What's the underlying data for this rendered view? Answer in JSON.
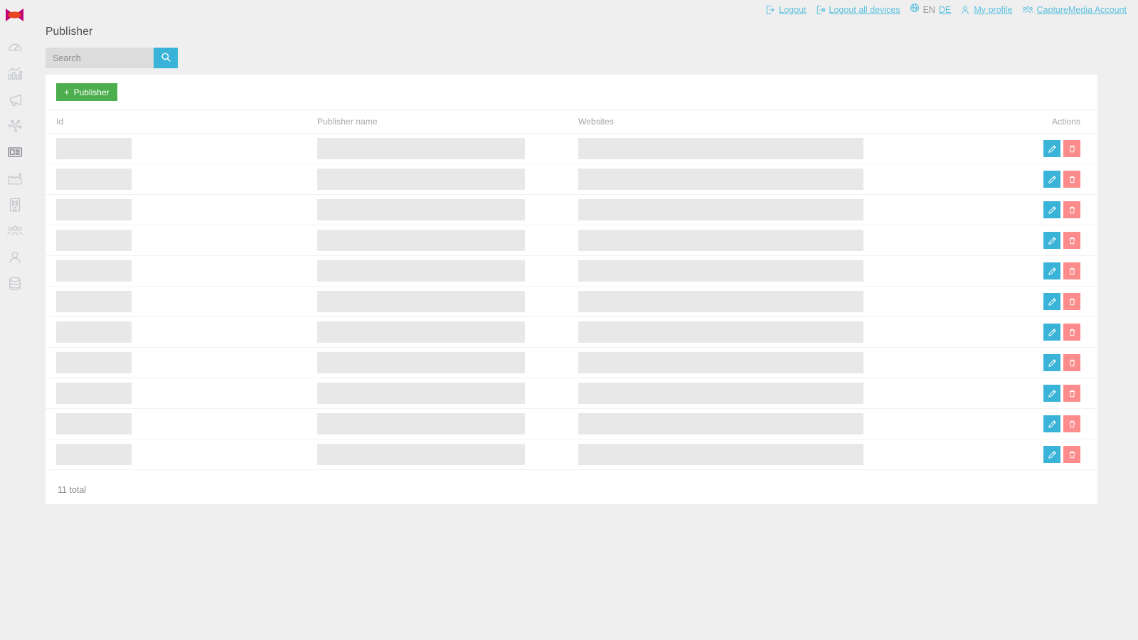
{
  "topbar": {
    "items": [
      {
        "icon": "logout-icon",
        "label": "Logout"
      },
      {
        "icon": "logout-all-devices-icon",
        "label": "Logout all devices"
      },
      {
        "icon": "my-profile-icon",
        "label": "My profile"
      },
      {
        "icon": "account-icon",
        "label": "CaptureMedia Account"
      }
    ],
    "logout_label": "Logout",
    "logout_all_label": "Logout all devices",
    "profile_label": "My profile",
    "account_label": "CaptureMedia Account",
    "language": {
      "icon": "globe-icon",
      "current": "EN",
      "other": "DE"
    },
    "link_color": "#5bc0de"
  },
  "sidebar": {
    "logo": "capturemedia-logo",
    "items": [
      {
        "icon": "gauge-icon",
        "name": "dashboard",
        "active": false
      },
      {
        "icon": "bar-chart-icon",
        "name": "statistics",
        "active": false
      },
      {
        "icon": "megaphone-icon",
        "name": "campaigns",
        "active": false
      },
      {
        "icon": "network-nodes-icon",
        "name": "network",
        "active": false
      },
      {
        "icon": "newspaper-icon",
        "name": "publisher",
        "active": true
      },
      {
        "icon": "factory-icon",
        "name": "advertiser",
        "active": false
      },
      {
        "icon": "building-icon",
        "name": "agency",
        "active": false
      },
      {
        "icon": "people-group-icon",
        "name": "users",
        "active": false
      },
      {
        "icon": "person-icon",
        "name": "profile",
        "active": false
      },
      {
        "icon": "database-icon",
        "name": "data",
        "active": false
      }
    ],
    "toggle": {
      "icon": "chevron-right-icon",
      "name": "expand-sidebar"
    }
  },
  "page": {
    "title": "Publisher"
  },
  "search": {
    "placeholder": "Search",
    "value": "",
    "button_icon": "search-icon"
  },
  "toolbar": {
    "add_label": "Publisher",
    "add_prefix": "+",
    "add_color": "#4cae4c"
  },
  "table": {
    "columns": [
      "Id",
      "Publisher name",
      "Websites",
      "Actions"
    ],
    "row_count": 11,
    "loading": true,
    "rows": [
      {
        "id": "",
        "publisher_name": "",
        "websites": ""
      },
      {
        "id": "",
        "publisher_name": "",
        "websites": ""
      },
      {
        "id": "",
        "publisher_name": "",
        "websites": ""
      },
      {
        "id": "",
        "publisher_name": "",
        "websites": ""
      },
      {
        "id": "",
        "publisher_name": "",
        "websites": ""
      },
      {
        "id": "",
        "publisher_name": "",
        "websites": ""
      },
      {
        "id": "",
        "publisher_name": "",
        "websites": ""
      },
      {
        "id": "",
        "publisher_name": "",
        "websites": ""
      },
      {
        "id": "",
        "publisher_name": "",
        "websites": ""
      },
      {
        "id": "",
        "publisher_name": "",
        "websites": ""
      },
      {
        "id": "",
        "publisher_name": "",
        "websites": ""
      }
    ],
    "row_actions": {
      "edit_icon": "pencil-icon",
      "delete_icon": "trash-icon",
      "edit_color": "#39b3d7",
      "delete_color": "#fc8b8b"
    },
    "footer_total": "11 total"
  }
}
